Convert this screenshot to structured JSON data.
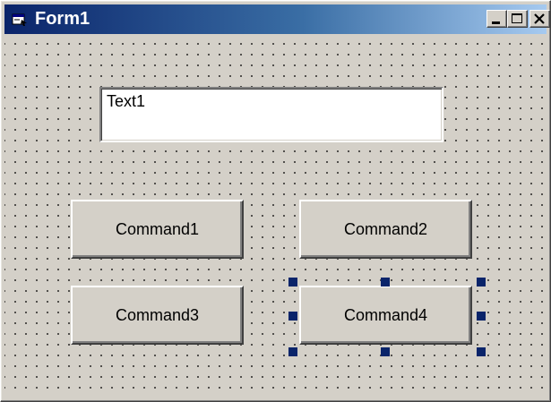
{
  "window": {
    "title": "Form1",
    "title_bar_color": "#0a246a",
    "icon": "form-icon",
    "caption_buttons": [
      "minimize-icon",
      "maximize-icon",
      "close-icon"
    ]
  },
  "form": {
    "background_color": "#d4d0c8",
    "grid": "dotted",
    "textbox": {
      "value": "Text1"
    },
    "buttons": [
      {
        "label": "Command1",
        "selected": false
      },
      {
        "label": "Command2",
        "selected": false
      },
      {
        "label": "Command3",
        "selected": false
      },
      {
        "label": "Command4",
        "selected": true
      }
    ],
    "selection_handle_color": "#0a246a"
  }
}
